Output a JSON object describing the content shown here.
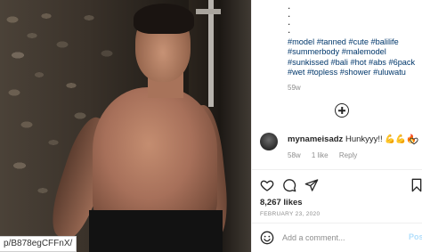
{
  "photo": {
    "url_text": "p/B878egCFFnX/"
  },
  "caption": {
    "dots": [
      ".",
      ".",
      ".",
      "."
    ],
    "hashtags": [
      "#model",
      "#tanned",
      "#cute",
      "#balilife",
      "#summerbody",
      "#malemodel",
      "#sunkissed",
      "#bali",
      "#hot",
      "#abs",
      "#6pack",
      "#wet",
      "#topless",
      "#shower",
      "#uluwatu"
    ],
    "time": "59w"
  },
  "comment": {
    "username": "mynameisadz",
    "text": "Hunkyyy!! 💪💪🔥",
    "time": "58w",
    "likes": "1 like",
    "reply_label": "Reply"
  },
  "post": {
    "likes": "8,267 likes",
    "date": "FEBRUARY 23, 2020"
  },
  "add_comment": {
    "placeholder": "Add a comment...",
    "post_label": "Post"
  },
  "colors": {
    "link": "#00376b",
    "muted": "#8e8e8e",
    "text": "#262626",
    "post_disabled": "#b2dffc"
  },
  "icons": [
    "load-more-icon",
    "heart-icon",
    "comment-icon",
    "share-icon",
    "bookmark-icon",
    "emoji-icon"
  ]
}
